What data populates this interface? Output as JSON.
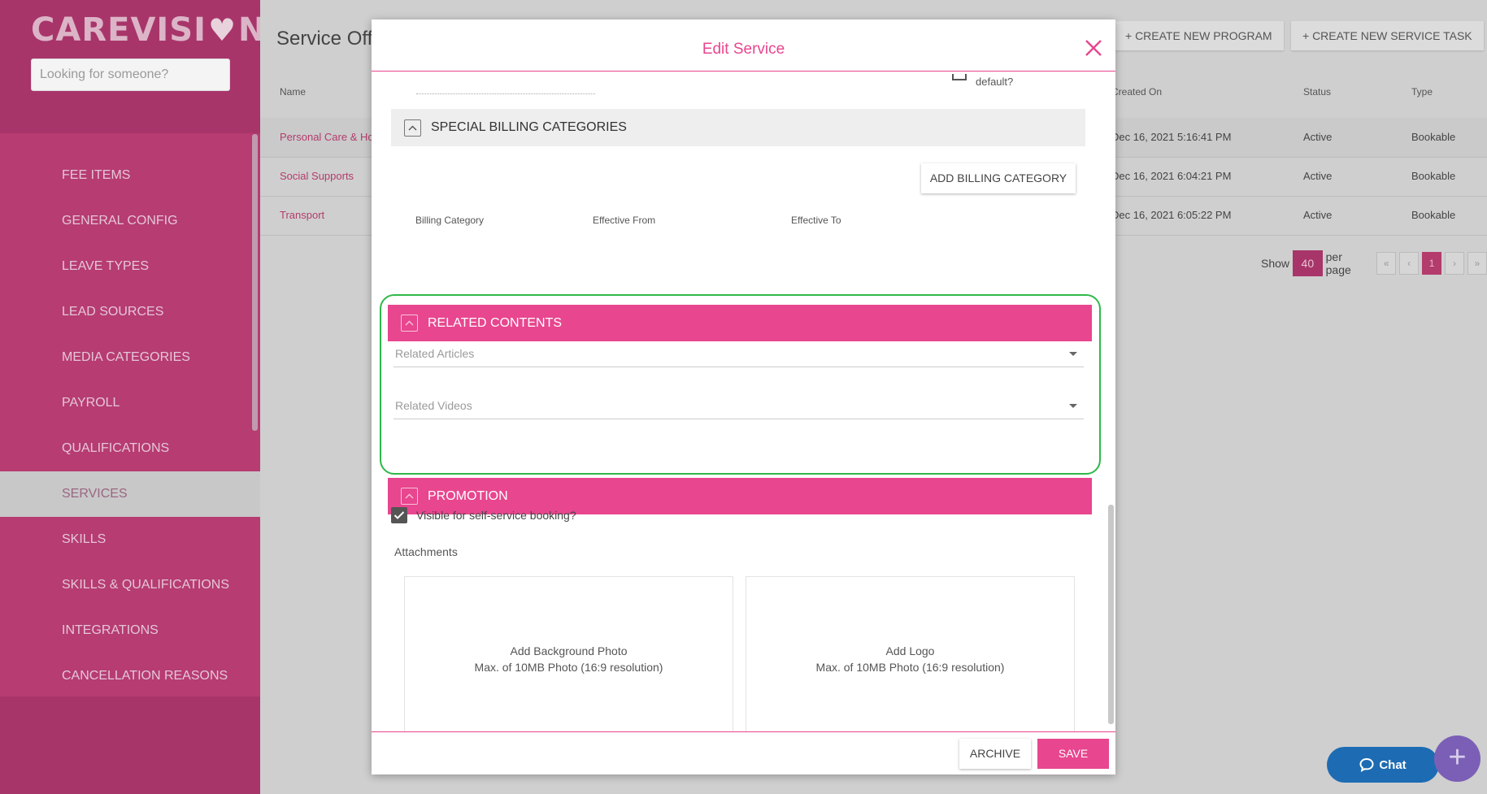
{
  "app": {
    "logo_pre": "CAREVISI",
    "logo_post": "N",
    "search_placeholder": "Looking for someone?"
  },
  "sidebar": {
    "items": [
      {
        "label": "FEE ITEMS"
      },
      {
        "label": "GENERAL CONFIG"
      },
      {
        "label": "LEAVE TYPES"
      },
      {
        "label": "LEAD SOURCES"
      },
      {
        "label": "MEDIA CATEGORIES"
      },
      {
        "label": "PAYROLL"
      },
      {
        "label": "QUALIFICATIONS"
      },
      {
        "label": "SERVICES",
        "active": true
      },
      {
        "label": "SKILLS"
      },
      {
        "label": "SKILLS & QUALIFICATIONS"
      },
      {
        "label": "INTEGRATIONS"
      },
      {
        "label": "CANCELLATION REASONS"
      }
    ]
  },
  "main": {
    "title": "Service Offerings",
    "create_program": "+ CREATE NEW PROGRAM",
    "create_task": "+ CREATE NEW SERVICE TASK",
    "columns": {
      "name": "Name",
      "created": "Created On",
      "status": "Status",
      "type": "Type"
    },
    "rows": [
      {
        "name": "Personal Care & Home",
        "created": "Dec 16, 2021 5:16:41 PM",
        "status": "Active",
        "type": "Bookable"
      },
      {
        "name": "Social Supports",
        "created": "Dec 16, 2021 6:04:21 PM",
        "status": "Active",
        "type": "Bookable"
      },
      {
        "name": "Transport",
        "created": "Dec 16, 2021 6:05:22 PM",
        "status": "Active",
        "type": "Bookable"
      }
    ],
    "pager": {
      "show": "Show",
      "per_page_value": "40",
      "per_page": "per page",
      "first": "«",
      "prev": "‹",
      "current": "1",
      "next": "›",
      "last": "»"
    }
  },
  "modal": {
    "title": "Edit Service",
    "default_label": "default?",
    "billing": {
      "title": "SPECIAL BILLING CATEGORIES",
      "add_button": "ADD BILLING CATEGORY",
      "col_category": "Billing Category",
      "col_from": "Effective From",
      "col_to": "Effective To"
    },
    "related": {
      "title": "RELATED CONTENTS",
      "articles_placeholder": "Related Articles",
      "videos_placeholder": "Related Videos"
    },
    "promotion": {
      "title": "PROMOTION",
      "visible_label": "Visible for self-service booking?",
      "visible_checked": true,
      "attachments_label": "Attachments",
      "bg_photo_title": "Add Background Photo",
      "bg_photo_hint": "Max. of 10MB Photo (16:9 resolution)",
      "logo_title": "Add Logo",
      "logo_hint": "Max. of 10MB Photo (16:9 resolution)"
    },
    "archive_button": "ARCHIVE",
    "save_button": "SAVE"
  },
  "chat": {
    "label": "Chat"
  },
  "colors": {
    "brand": "#e8468f",
    "sidebar": "#b63c72",
    "highlight": "#2fb84a",
    "chat": "#1d6cb3"
  }
}
